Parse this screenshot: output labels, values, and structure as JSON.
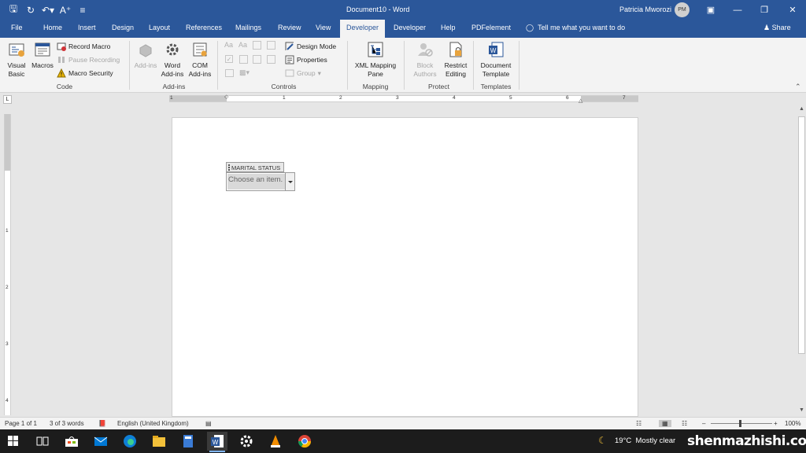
{
  "titlebar": {
    "document_title": "Document10 - Word",
    "user_name": "Patricia Mworozi",
    "user_initials": "PM"
  },
  "tabs": [
    "File",
    "Home",
    "Insert",
    "Design",
    "Layout",
    "References",
    "Mailings",
    "Review",
    "View",
    "Developer",
    "Developer",
    "Help",
    "PDFelement"
  ],
  "active_tab": "Developer",
  "tell_me": "Tell me what you want to do",
  "share_label": "Share",
  "ribbon": {
    "code": {
      "visual_basic": "Visual Basic",
      "macros": "Macros",
      "record_macro": "Record Macro",
      "pause_recording": "Pause Recording",
      "macro_security": "Macro Security",
      "label": "Code"
    },
    "addins": {
      "add_ins": "Add-ins",
      "word_addins": "Word Add-ins",
      "com_addins": "COM Add-ins",
      "label": "Add-ins"
    },
    "controls": {
      "design_mode": "Design Mode",
      "properties": "Properties",
      "group": "Group",
      "label": "Controls"
    },
    "mapping": {
      "xml_mapping_pane": "XML Mapping Pane",
      "label": "Mapping"
    },
    "protect": {
      "block_authors": "Block Authors",
      "restrict_editing": "Restrict Editing",
      "label": "Protect"
    },
    "templates": {
      "document_template": "Document Template",
      "label": "Templates"
    }
  },
  "ruler": {
    "horizontal_numbers": [
      "1",
      "1",
      "2",
      "3",
      "4",
      "5",
      "6",
      "7"
    ],
    "vertical_numbers": [
      "1",
      "2",
      "3",
      "4"
    ]
  },
  "content_control": {
    "title": "MARITAL STATUS",
    "placeholder": "Choose an item."
  },
  "statusbar": {
    "page": "Page 1 of 1",
    "words": "3 of 3 words",
    "language": "English (United Kingdom)",
    "zoom_minus": "–",
    "zoom_plus": "+",
    "zoom": "100%"
  },
  "taskbar": {
    "temperature": "19°C",
    "condition": "Mostly clear",
    "watermark": "shenmazhishi.com"
  }
}
